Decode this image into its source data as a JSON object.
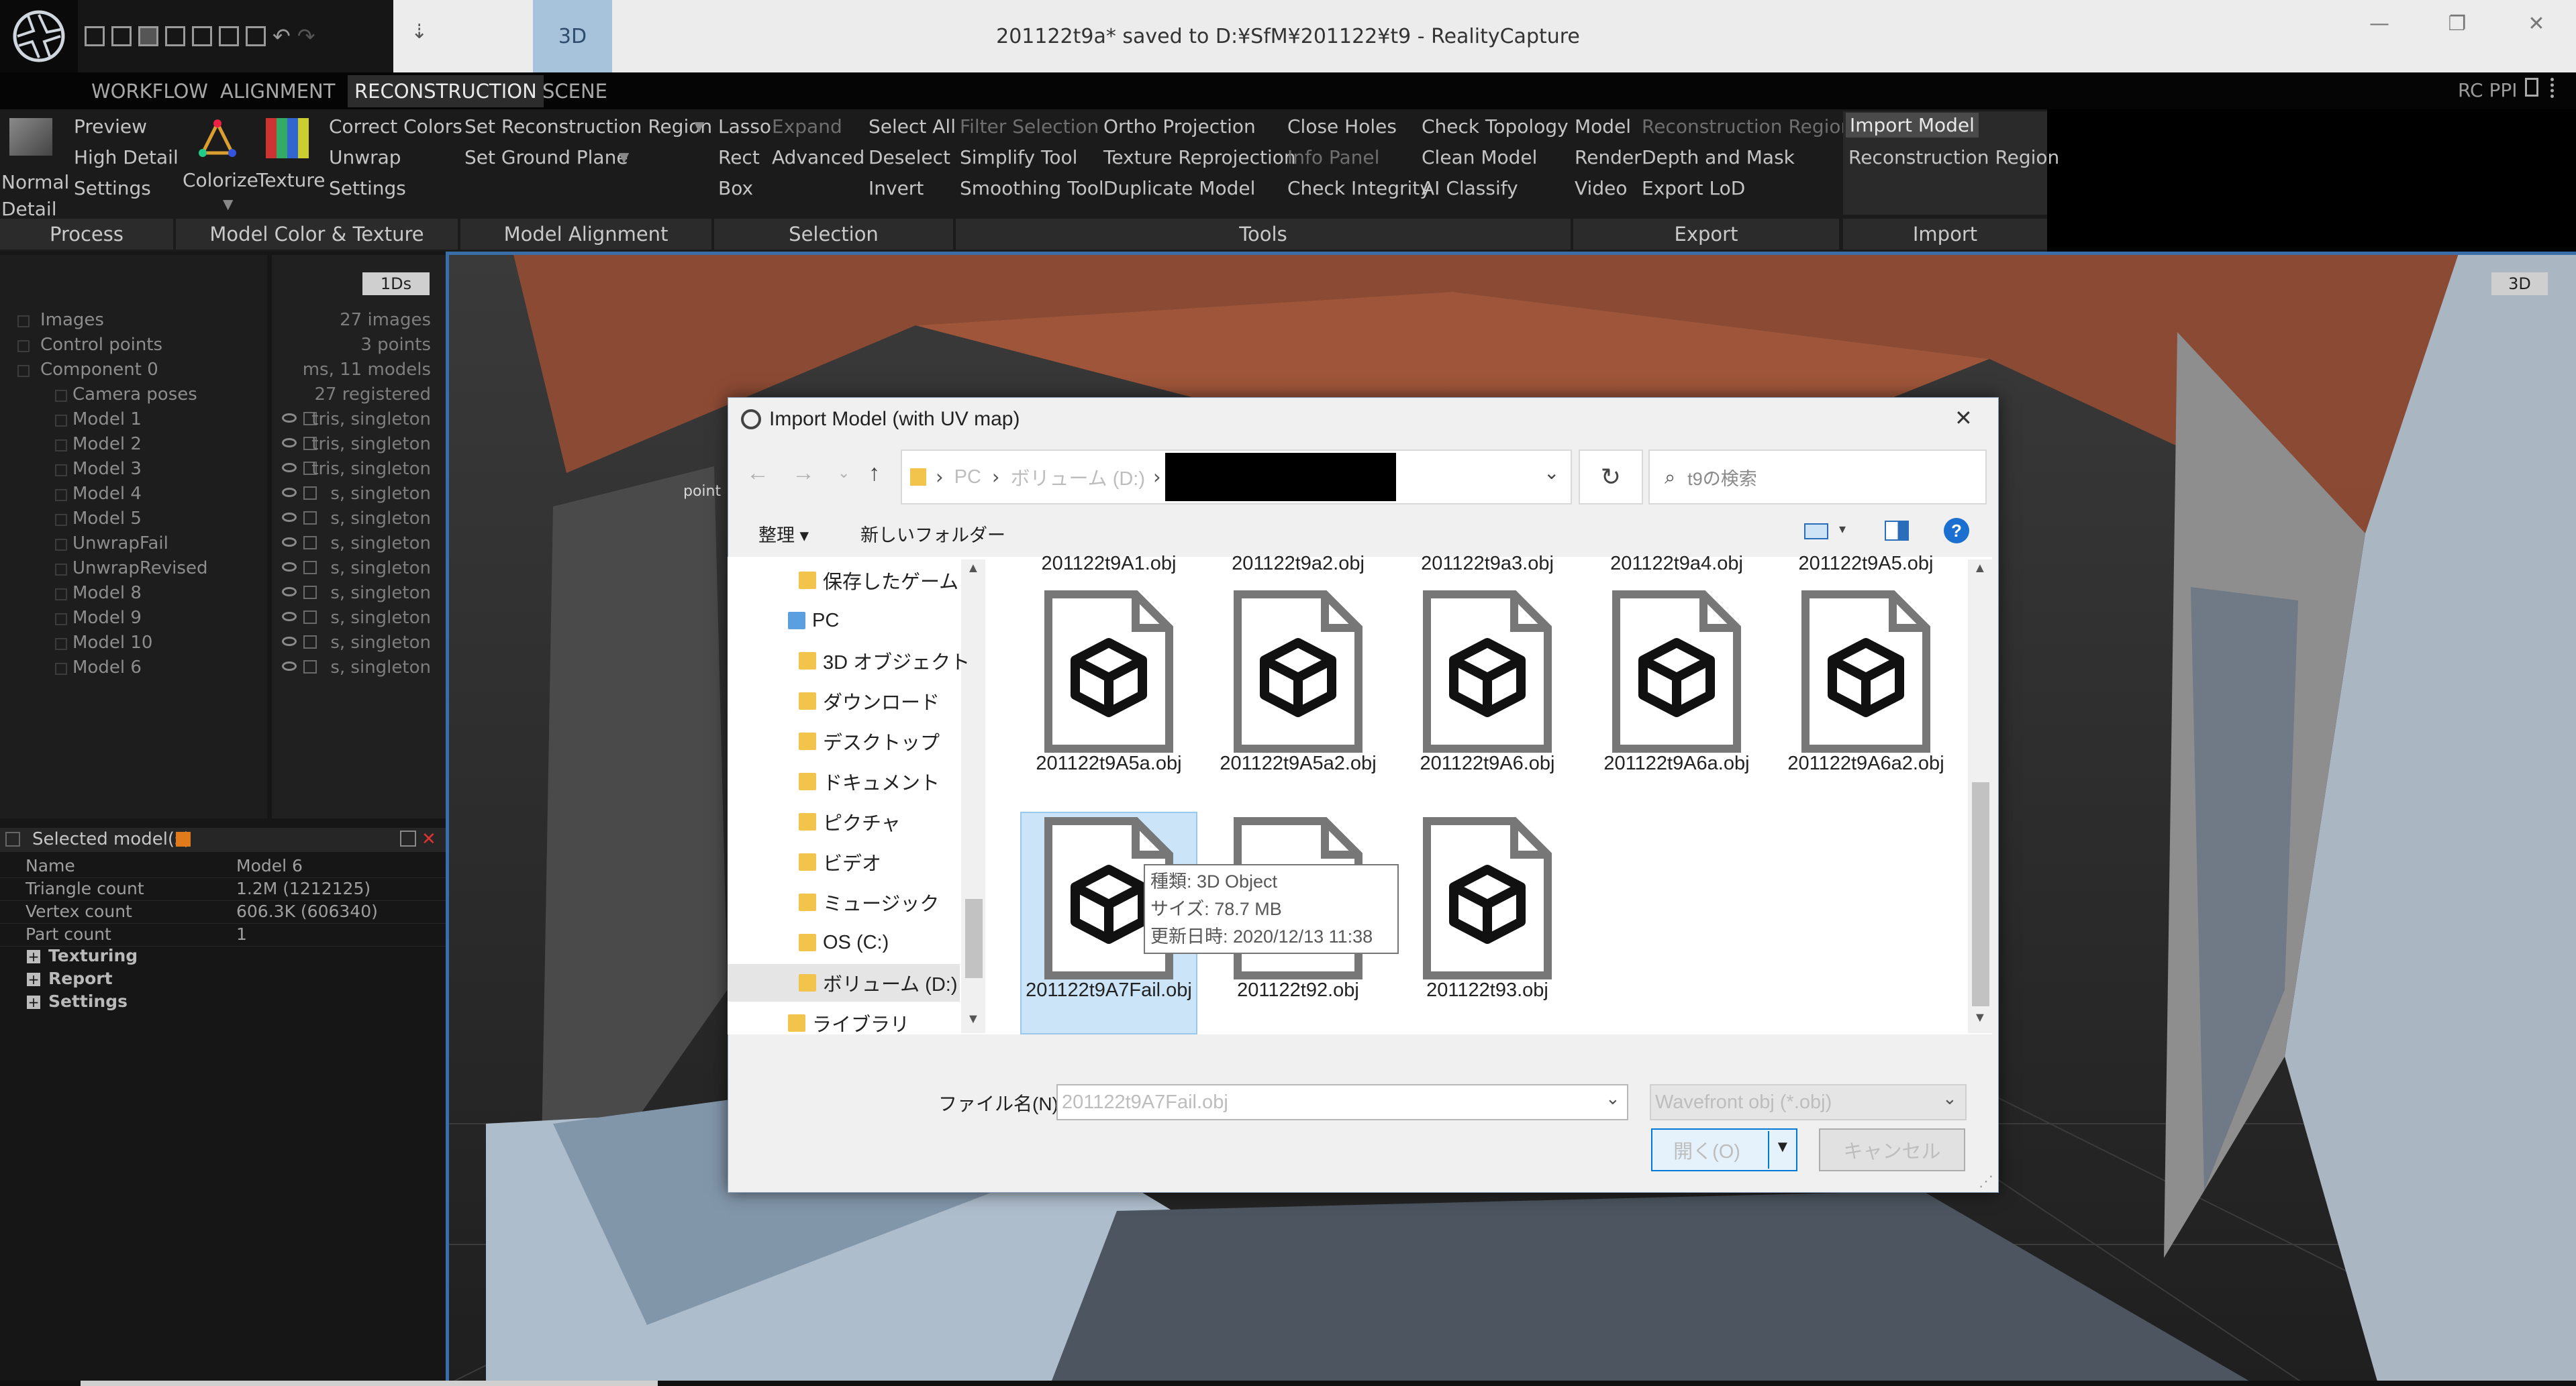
{
  "window": {
    "title": "201122t9a* saved to D:¥SfM¥201122¥t9 - RealityCapture",
    "tab_3d": "3D",
    "minimize": "—",
    "maximize": "❐",
    "close": "✕"
  },
  "menu_tabs": [
    "WORKFLOW",
    "ALIGNMENT",
    "RECONSTRUCTION",
    "SCENE"
  ],
  "ribbon": {
    "process": {
      "label": "Process",
      "normal_detail": "Normal Detail",
      "preview": "Preview",
      "high_detail": "High Detail",
      "settings": "Settings"
    },
    "color_texture": {
      "label": "Model Color & Texture",
      "colorize": "Colorize",
      "texture": "Texture",
      "correct_colors": "Correct Colors",
      "unwrap": "Unwrap",
      "settings": "Settings"
    },
    "alignment": {
      "label": "Model Alignment",
      "set_region": "Set Reconstruction Region",
      "set_ground": "Set Ground Plane"
    },
    "selection": {
      "label": "Selection",
      "lasso": "Lasso",
      "expand": "Expand",
      "rect": "Rect",
      "advanced": "Advanced",
      "box": "Box",
      "select_all": "Select All",
      "deselect": "Deselect",
      "invert": "Invert"
    },
    "tools": {
      "label": "Tools",
      "filter_selection": "Filter Selection",
      "simplify": "Simplify Tool",
      "smoothing": "Smoothing Tool",
      "ortho": "Ortho Projection",
      "texture_reproj": "Texture Reprojection",
      "duplicate": "Duplicate Model",
      "close_holes": "Close Holes",
      "info_panel": "Info Panel",
      "check_integrity": "Check Integrity",
      "check_topology": "Check Topology",
      "clean_model": "Clean Model",
      "ai_classify": "AI Classify"
    },
    "export": {
      "label": "Export",
      "model": "Model",
      "render": "Render",
      "video": "Video",
      "reconstruction_region": "Reconstruction Region",
      "depth_mask": "Depth and Mask",
      "export_lod": "Export LoD"
    },
    "import": {
      "label": "Import",
      "import_model": "Import Model",
      "reconstruction_region": "Reconstruction Region"
    },
    "rc_ppi": "RC PPI"
  },
  "tree": {
    "view_button": "1Ds",
    "rows": [
      {
        "label": "Images",
        "info": "27 images"
      },
      {
        "label": "Control points",
        "info": "3 points"
      },
      {
        "label": "Component 0",
        "info": "ms, 11 models"
      },
      {
        "label": "Camera poses",
        "info": "27 registered"
      },
      {
        "label": "Model 1",
        "info": "tris, singleton"
      },
      {
        "label": "Model 2",
        "info": "tris, singleton"
      },
      {
        "label": "Model 3",
        "info": "tris, singleton"
      },
      {
        "label": "Model 4",
        "info": "s, singleton"
      },
      {
        "label": "Model 5",
        "info": "s, singleton"
      },
      {
        "label": "UnwrapFail",
        "info": "s, singleton"
      },
      {
        "label": "UnwrapRevised",
        "info": "s, singleton"
      },
      {
        "label": "Model 8",
        "info": "s, singleton"
      },
      {
        "label": "Model 9",
        "info": "s, singleton"
      },
      {
        "label": "Model 10",
        "info": "s, singleton"
      },
      {
        "label": "Model 6",
        "info": "s, singleton"
      }
    ]
  },
  "properties": {
    "header": "Selected model(s)",
    "rows": [
      {
        "key": "Name",
        "value": "Model 6"
      },
      {
        "key": "Triangle count",
        "value": "1.2M (1212125)"
      },
      {
        "key": "Vertex count",
        "value": "606.3K (606340)"
      },
      {
        "key": "Part count",
        "value": "1"
      }
    ],
    "sections": [
      "Texturing",
      "Report",
      "Settings"
    ]
  },
  "viewport": {
    "badge": "3D",
    "label_point": "point"
  },
  "dialog": {
    "title": "Import Model (with UV map)",
    "breadcrumb": [
      "PC",
      "ボリューム (D:)"
    ],
    "search_placeholder": "t9の検索",
    "organize": "整理 ▾",
    "new_folder": "新しいフォルダー",
    "nav_items": [
      {
        "label": "保存したゲーム",
        "indent": 2
      },
      {
        "label": "PC",
        "indent": 1
      },
      {
        "label": "3D オブジェクト",
        "indent": 2
      },
      {
        "label": "ダウンロード",
        "indent": 2
      },
      {
        "label": "デスクトップ",
        "indent": 2
      },
      {
        "label": "ドキュメント",
        "indent": 2
      },
      {
        "label": "ピクチャ",
        "indent": 2
      },
      {
        "label": "ビデオ",
        "indent": 2
      },
      {
        "label": "ミュージック",
        "indent": 2
      },
      {
        "label": "OS (C:)",
        "indent": 2
      },
      {
        "label": "ボリューム (D:)",
        "indent": 2
      },
      {
        "label": "ライブラリ",
        "indent": 1
      }
    ],
    "top_row_files": [
      "201122t9A1.obj",
      "201122t9a2.obj",
      "201122t9a3.obj",
      "201122t9a4.obj",
      "201122t9A5.obj"
    ],
    "files_row1": [
      "201122t9A5a.obj",
      "201122t9A5a2.obj",
      "201122t9A6.obj",
      "201122t9A6a.obj",
      "201122t9A6a2.obj"
    ],
    "files_row2": [
      "201122t9A7Fail.obj",
      "201122t92.obj",
      "201122t93.obj"
    ],
    "tooltip": {
      "type": "種類: 3D Object",
      "size": "サイズ: 78.7 MB",
      "modified": "更新日時: 2020/12/13 11:38"
    },
    "filename_label": "ファイル名(N):",
    "filename_value": "201122t9A7Fail.obj",
    "filetype": "Wavefront obj (*.obj)",
    "open_button": "開く(O)",
    "cancel_button": "キャンセル"
  }
}
